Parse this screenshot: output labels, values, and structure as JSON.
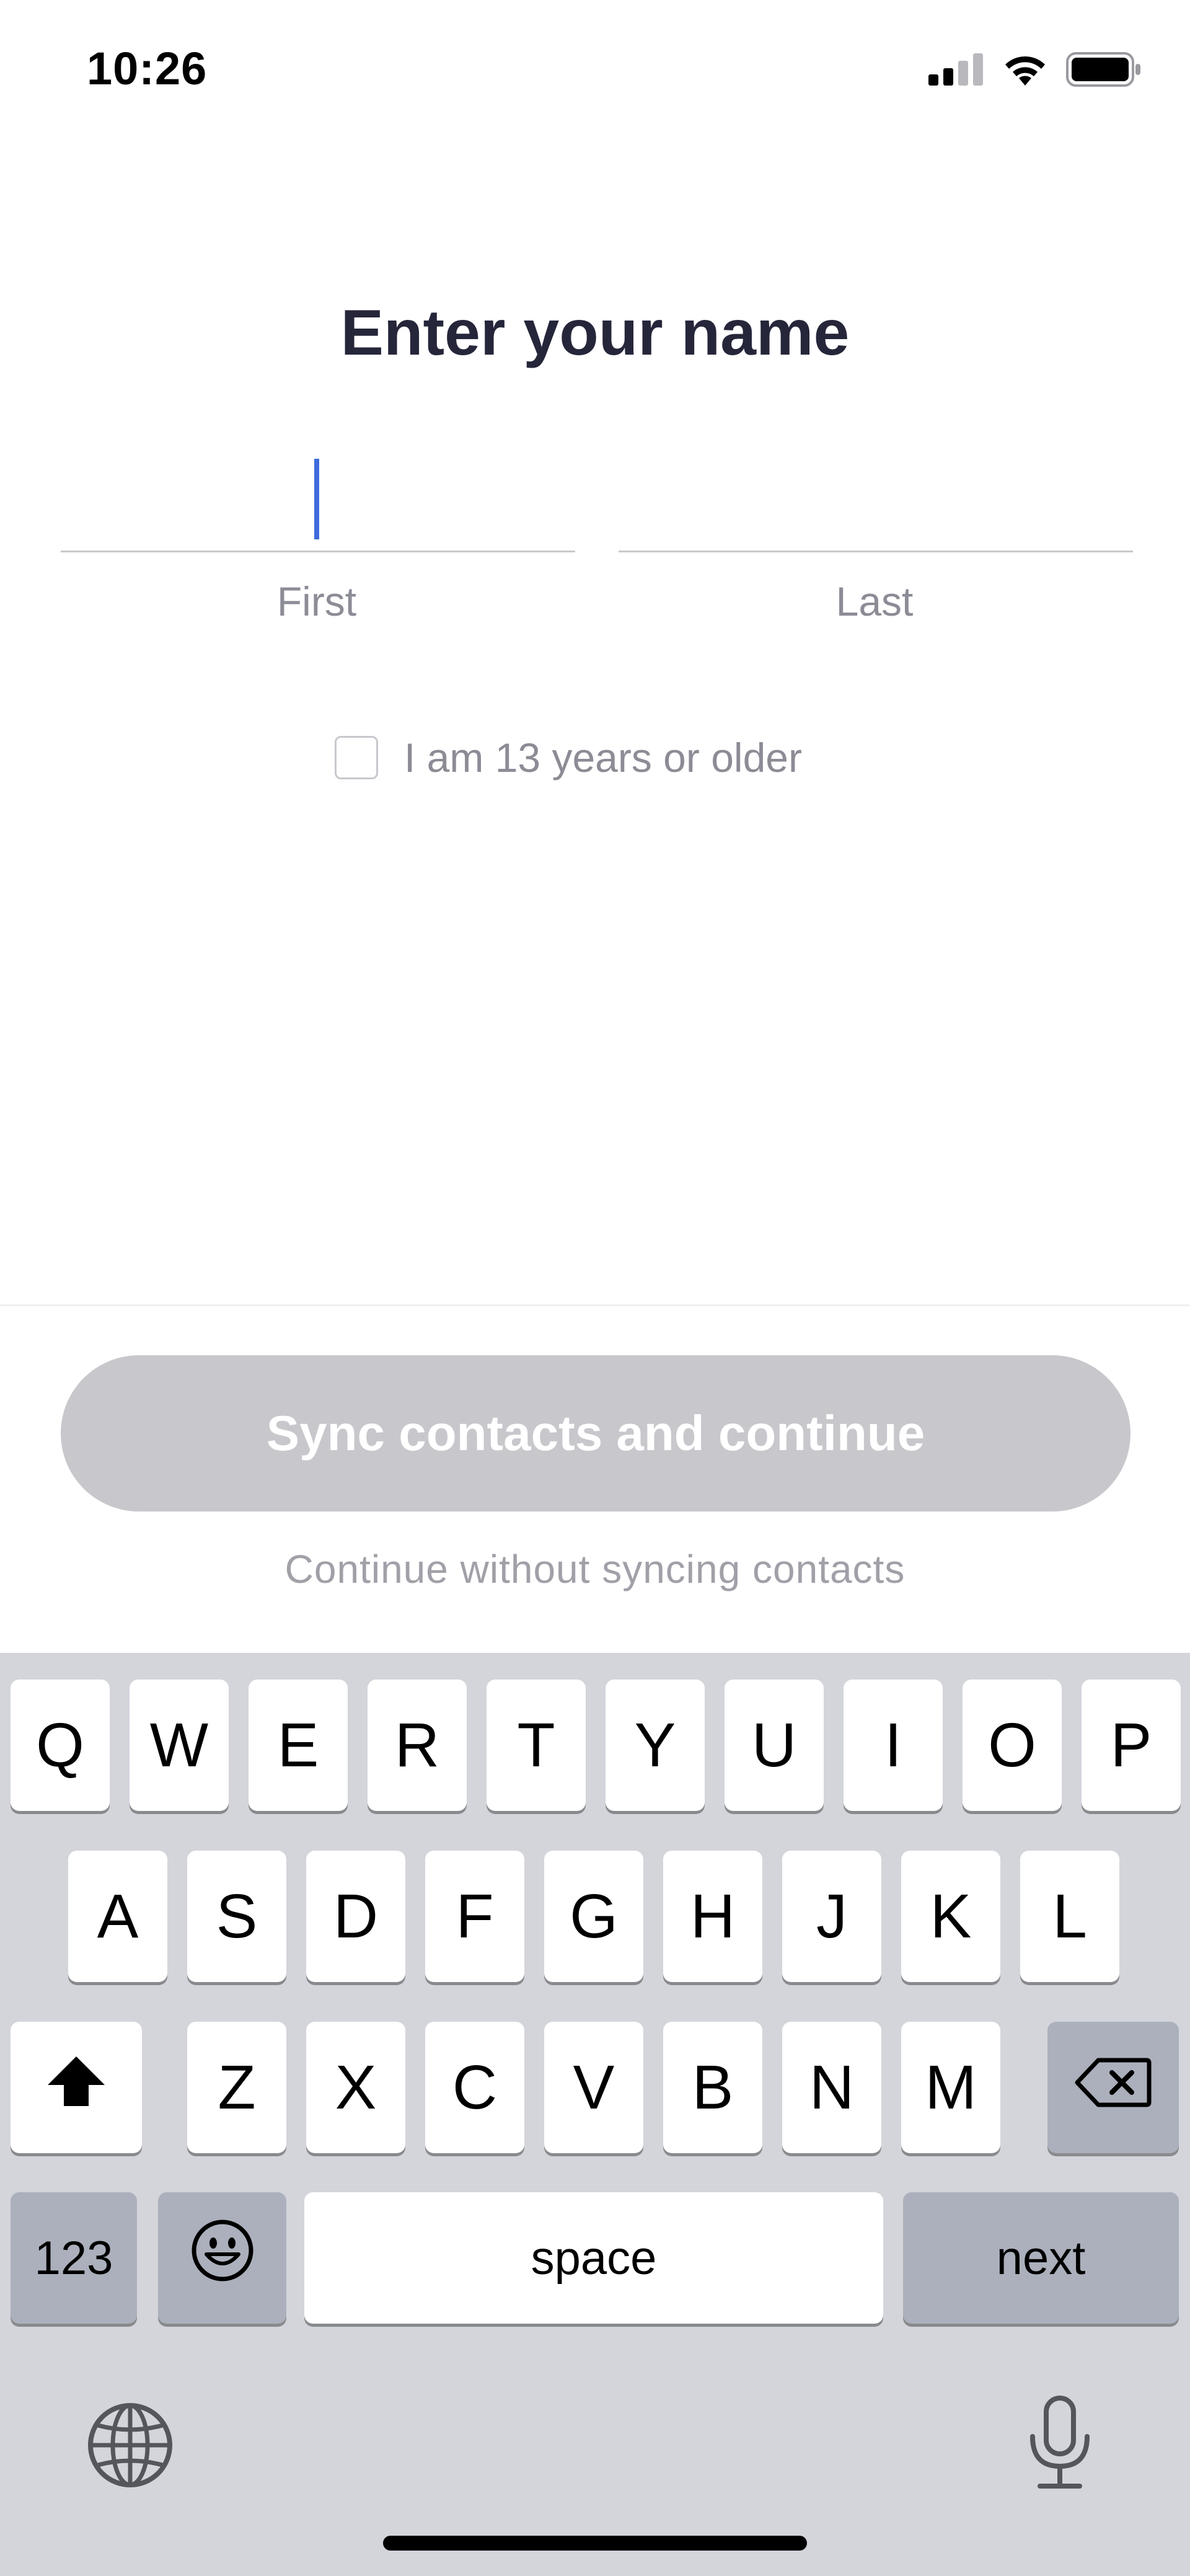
{
  "status_bar": {
    "time": "10:26",
    "icons": [
      "cellular-signal-icon",
      "wifi-icon",
      "battery-icon"
    ]
  },
  "title": "Enter your name",
  "name_form": {
    "first": {
      "value": "",
      "label": "First"
    },
    "last": {
      "value": "",
      "label": "Last"
    }
  },
  "age_check": {
    "label": "I am 13 years or older",
    "checked": false
  },
  "sync_button_label": "Sync contacts and continue",
  "skip_link": "Continue without syncing contacts",
  "keyboard": {
    "row1": [
      "Q",
      "W",
      "E",
      "R",
      "T",
      "Y",
      "U",
      "I",
      "O",
      "P"
    ],
    "row2": [
      "A",
      "S",
      "D",
      "F",
      "G",
      "H",
      "J",
      "K",
      "L"
    ],
    "row3": [
      "Z",
      "X",
      "C",
      "V",
      "B",
      "N",
      "M"
    ],
    "numbers_label": "123",
    "space_label": "space",
    "return_label": "next",
    "icons": [
      "shift-icon",
      "backspace-icon",
      "emoji-icon",
      "globe-icon",
      "microphone-icon"
    ]
  },
  "colors": {
    "title": "#25263a",
    "caret": "#3d6bdc",
    "button_disabled": "#c7c7cc",
    "keyboard_bg": "#d3d5db"
  }
}
